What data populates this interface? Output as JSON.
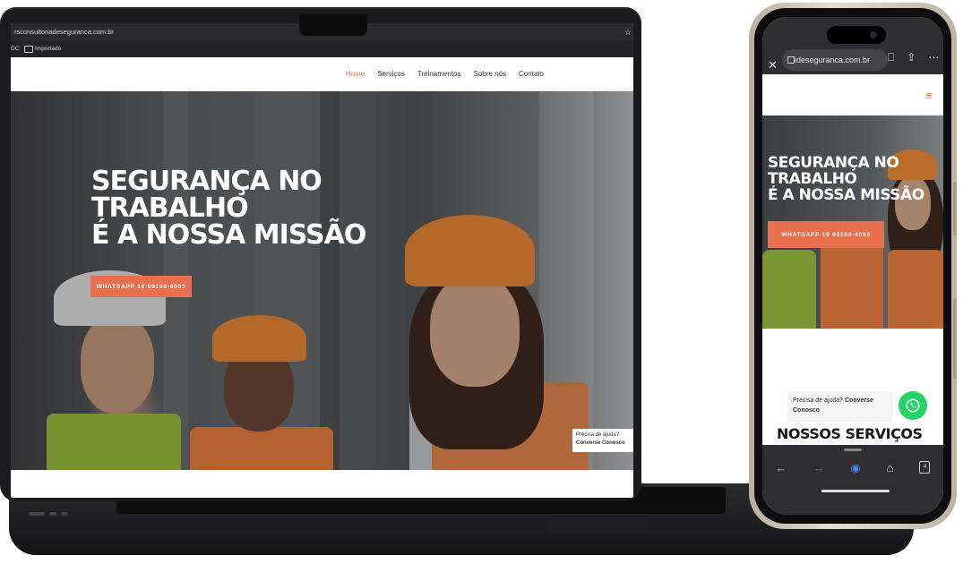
{
  "laptop": {
    "browser": {
      "url": "rsconsultoriadeseguranca.com.br",
      "bookmark_short": "DC",
      "bookmark_folder": "Importado",
      "star_icon": "star-icon"
    },
    "nav": {
      "items": [
        "Home",
        "Serviços",
        "Treinamentos",
        "Sobre nós",
        "Contato"
      ],
      "active_index": 0,
      "active_color": "#e8704f"
    },
    "hero": {
      "title_lines": [
        "SEGURANÇA NO",
        "TRABALHO",
        "É A NOSSA MISSÃO"
      ],
      "button_label": "WHATSAPP 19 99168-4003",
      "accent_color": "#e8704f"
    },
    "help": {
      "text": "Precisa de ajuda?",
      "link": "Converse Conosco"
    }
  },
  "phone": {
    "browser": {
      "url": "ideseguranca.com.br",
      "close_icon": "close-icon",
      "bookmark_icon": "bookmark-icon",
      "share_icon": "share-icon",
      "more_icon": "more-icon"
    },
    "header": {
      "menu_icon": "hamburger-icon"
    },
    "hero": {
      "title_lines": [
        "SEGURANÇA NO",
        "TRABALHO",
        "É A NOSSA MISSÃO"
      ],
      "button_label": "WHATSAPP 19 99168-4003"
    },
    "help": {
      "text": "Precisa de ajuda?",
      "link": "Converse Conosco"
    },
    "section_title": "NOSSOS SERVIÇOS",
    "bottom_bar": {
      "tab_count": "4"
    }
  }
}
